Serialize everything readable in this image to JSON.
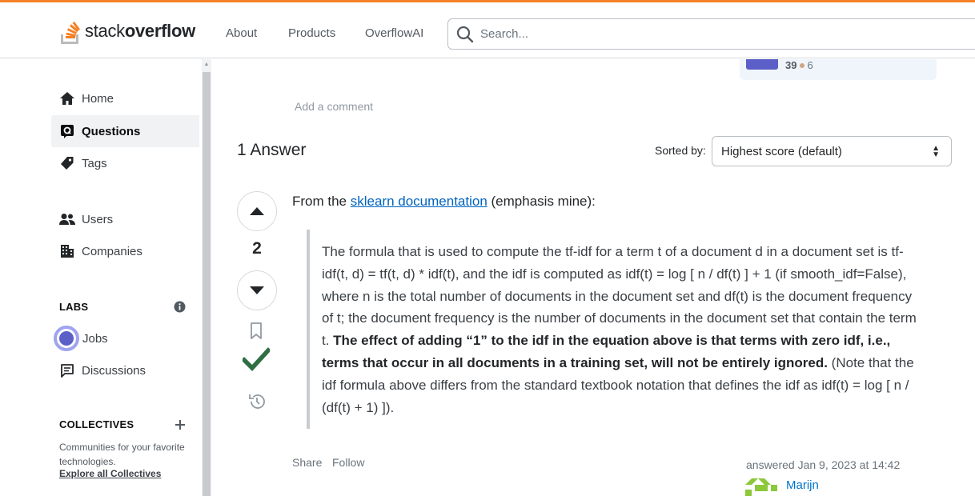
{
  "header": {
    "logo_text_light": "stack",
    "logo_text_bold": "overflow",
    "nav": [
      "About",
      "Products",
      "OverflowAI"
    ],
    "search_placeholder": "Search..."
  },
  "sidebar": {
    "items": [
      {
        "label": "Home",
        "icon": "home-icon"
      },
      {
        "label": "Questions",
        "icon": "questions-icon",
        "active": true
      },
      {
        "label": "Tags",
        "icon": "tag-icon"
      },
      {
        "label": "Users",
        "icon": "users-icon"
      },
      {
        "label": "Companies",
        "icon": "companies-icon"
      }
    ],
    "labs_heading": "LABS",
    "labs_items": [
      {
        "label": "Jobs",
        "icon": "jobs-icon"
      },
      {
        "label": "Discussions",
        "icon": "discussions-icon"
      }
    ],
    "collectives_heading": "COLLECTIVES",
    "collectives_desc": "Communities for your favorite technologies.",
    "explore_link": "Explore all Collectives"
  },
  "collective_card": {
    "reputation": "39",
    "bronze": "6"
  },
  "main": {
    "add_comment": "Add a comment",
    "answer_count": "1 Answer",
    "sorted_by_label": "Sorted by:",
    "sort_value": "Highest score (default)",
    "vote_count": "2",
    "intro_prefix": "From the ",
    "intro_link": "sklearn documentation",
    "intro_suffix": " (emphasis mine):",
    "quote_plain_1": "The formula that is used to compute the tf-idf for a term t of a document d in a document set is tf-idf(t, d) = tf(t, d) * idf(t), and the idf is computed as idf(t) = log [ n / df(t) ] + 1 (if smooth_idf=False), where n is the total number of documents in the document set and df(t) is the document frequency of t; the document frequency is the number of documents in the document set that contain the term t. ",
    "quote_bold": "The effect of adding “1” to the idf in the equation above is that terms with zero idf, i.e., terms that occur in all documents in a training set, will not be entirely ignored.",
    "quote_plain_2": " (Note that the idf formula above differs from the standard textbook notation that defines the idf as idf(t) = log [ n / (df(t) + 1) ]).",
    "share": "Share",
    "follow": "Follow",
    "answered_at": "answered Jan 9, 2023 at 14:42",
    "user_name": "Marijn"
  },
  "colors": {
    "accent_orange": "#f48225",
    "link_blue": "#0063bf",
    "accepted_green": "#2f6f44",
    "collective_purple": "#5b5fc7"
  }
}
